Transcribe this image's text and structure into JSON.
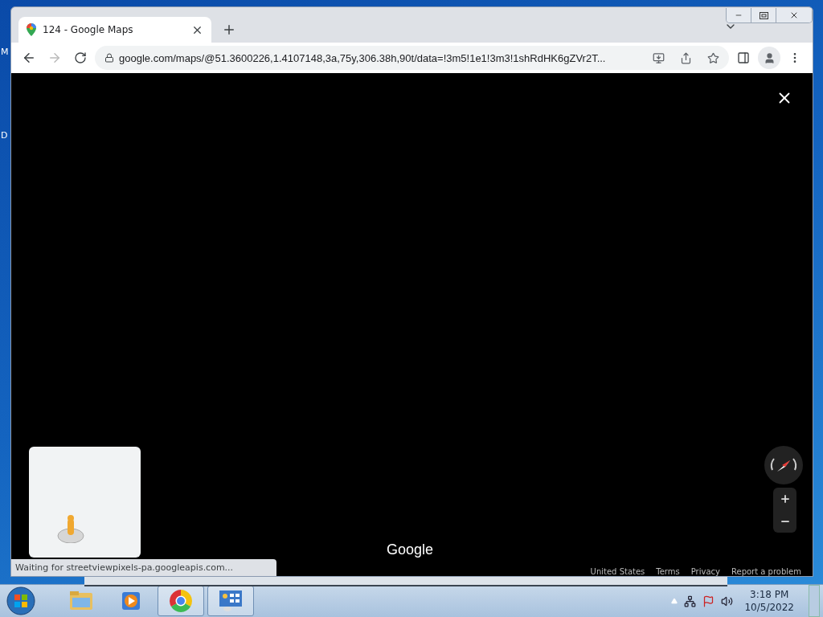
{
  "desktop": {
    "icon_labels": [
      "M",
      "D"
    ]
  },
  "browser": {
    "tabs": [
      {
        "title": "124 - Google Maps",
        "selected": true
      }
    ],
    "back": {
      "disabled": false
    },
    "forward": {
      "disabled": true
    },
    "address": "google.com/maps/@51.3600226,1.4107148,3a,75y,306.38h,90t/data=!3m5!1e1!3m3!1shRdHK6gZVr2T...",
    "status": "Waiting for streetviewpixels-pa.googleapis.com..."
  },
  "map": {
    "logo": "Google",
    "footer_links": [
      "United States",
      "Terms",
      "Privacy",
      "Report a problem"
    ]
  },
  "taskbar": {
    "apps": [
      {
        "kind": "explorer",
        "open": false
      },
      {
        "kind": "media",
        "open": false
      },
      {
        "kind": "chrome",
        "open": true
      },
      {
        "kind": "control-panel",
        "open": true
      }
    ],
    "time": "3:18 PM",
    "date": "10/5/2022"
  }
}
